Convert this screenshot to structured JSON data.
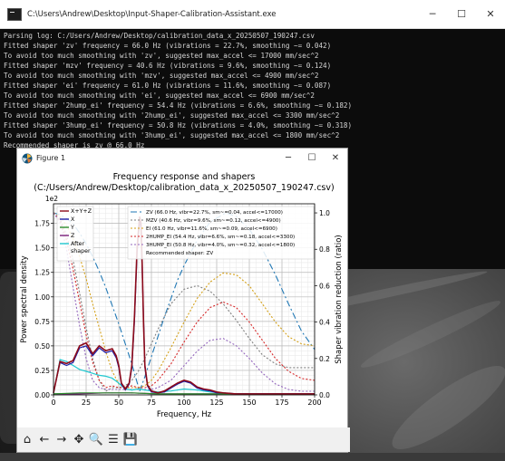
{
  "console": {
    "title": "C:\\Users\\Andrew\\Desktop\\Input-Shaper-Calibration-Assistant.exe",
    "controls": {
      "minimize": "─",
      "maximize": "☐",
      "close": "✕"
    },
    "lines": [
      "Parsing log: C:/Users/Andrew/Desktop/calibration_data_x_20250507_190247.csv",
      "Fitted shaper 'zv' frequency = 66.0 Hz (vibrations = 22.7%, smoothing ~= 0.042)",
      "To avoid too much smoothing with 'zv', suggested max_accel <= 17000 mm/sec^2",
      "Fitted shaper 'mzv' frequency = 40.6 Hz (vibrations = 9.6%, smoothing ~= 0.124)",
      "To avoid too much smoothing with 'mzv', suggested max_accel <= 4900 mm/sec^2",
      "Fitted shaper 'ei' frequency = 61.0 Hz (vibrations = 11.6%, smoothing ~= 0.087)",
      "To avoid too much smoothing with 'ei', suggested max_accel <= 6900 mm/sec^2",
      "Fitted shaper '2hump_ei' frequency = 54.4 Hz (vibrations = 6.6%, smoothing ~= 0.182)",
      "To avoid too much smoothing with '2hump_ei', suggested max_accel <= 3300 mm/sec^2",
      "Fitted shaper '3hump_ei' frequency = 50.8 Hz (vibrations = 4.0%, smoothing ~= 0.318)",
      "To avoid too much smoothing with '3hump_ei', suggested max_accel <= 1800 mm/sec^2",
      "Recommended shaper is zv @ 66.0 Hz"
    ]
  },
  "figure": {
    "title": "Figure 1",
    "controls": {
      "minimize": "─",
      "maximize": "☐",
      "close": "✕"
    },
    "toolbar": [
      "home-icon",
      "back-arrow-icon",
      "forward-arrow-icon",
      "pan-icon",
      "zoom-icon",
      "configure-subplots-icon",
      "save-icon"
    ],
    "toolbar_glyphs": [
      "⌂",
      "←",
      "→",
      "✥",
      "🔍",
      "☰",
      "💾"
    ]
  },
  "chart_data": {
    "type": "line",
    "title": "Frequency response and shapers",
    "subtitle": "(C:/Users/Andrew/Desktop/calibration_data_x_20250507_190247.csv)",
    "xlabel": "Frequency, Hz",
    "ylabel": "Power spectral density",
    "ylabel_right": "Shaper vibration reduction (ratio)",
    "y_multiplier": "1e2",
    "xlim": [
      0,
      200
    ],
    "ylim": [
      0,
      1.95
    ],
    "ylim_right": [
      0,
      1.05
    ],
    "xticks": [
      "0",
      "25",
      "50",
      "75",
      "100",
      "125",
      "150",
      "175",
      "200"
    ],
    "yticks": [
      "0.00",
      "0.25",
      "0.50",
      "0.75",
      "1.00",
      "1.25",
      "1.50",
      "1.75"
    ],
    "yticks_right": [
      "0.0",
      "0.2",
      "0.4",
      "0.6",
      "0.8",
      "1.0"
    ],
    "grid": true,
    "psd_series": [
      {
        "name": "X+Y+Z",
        "color": "#8b0a1a",
        "x": [
          0,
          5,
          10,
          15,
          20,
          25,
          30,
          35,
          40,
          45,
          48,
          50,
          52,
          55,
          58,
          60,
          62,
          64,
          66,
          67,
          68,
          69,
          70,
          72,
          75,
          80,
          85,
          90,
          95,
          100,
          105,
          110,
          115,
          120,
          125,
          130,
          140,
          160,
          180,
          200
        ],
        "y": [
          0.02,
          0.34,
          0.32,
          0.35,
          0.5,
          0.53,
          0.42,
          0.5,
          0.45,
          0.47,
          0.4,
          0.3,
          0.12,
          0.06,
          0.12,
          0.3,
          0.8,
          1.5,
          1.82,
          1.75,
          1.3,
          0.7,
          0.3,
          0.1,
          0.04,
          0.02,
          0.04,
          0.08,
          0.12,
          0.15,
          0.13,
          0.08,
          0.06,
          0.05,
          0.03,
          0.02,
          0.01,
          0.01,
          0.01,
          0.01
        ]
      },
      {
        "name": "X",
        "color": "#1e1ea8",
        "x": [
          0,
          5,
          10,
          15,
          20,
          25,
          30,
          35,
          40,
          45,
          48,
          50,
          52,
          55,
          58,
          60,
          62,
          64,
          66,
          67,
          68,
          70,
          72,
          75,
          80,
          85,
          90,
          95,
          100,
          105,
          110,
          115,
          120,
          125,
          130,
          140,
          160,
          180,
          200
        ],
        "y": [
          0.02,
          0.33,
          0.3,
          0.33,
          0.48,
          0.5,
          0.4,
          0.48,
          0.43,
          0.45,
          0.38,
          0.28,
          0.11,
          0.05,
          0.11,
          0.28,
          0.75,
          1.45,
          1.78,
          1.7,
          1.25,
          0.28,
          0.09,
          0.03,
          0.02,
          0.03,
          0.07,
          0.11,
          0.14,
          0.12,
          0.07,
          0.05,
          0.04,
          0.02,
          0.02,
          0.01,
          0.01,
          0.01,
          0.01
        ]
      },
      {
        "name": "Y",
        "color": "#2c8c2c",
        "x": [
          0,
          20,
          40,
          60,
          80,
          100,
          120,
          140,
          160,
          180,
          200
        ],
        "y": [
          0.01,
          0.02,
          0.02,
          0.02,
          0.01,
          0.01,
          0.01,
          0.01,
          0.01,
          0.01,
          0.01
        ]
      },
      {
        "name": "Z",
        "color": "#7a1f7a",
        "x": [
          0,
          20,
          40,
          60,
          80,
          100,
          120,
          140,
          160,
          180,
          200
        ],
        "y": [
          0.01,
          0.01,
          0.02,
          0.02,
          0.01,
          0.01,
          0.01,
          0.01,
          0.01,
          0.01,
          0.01
        ]
      },
      {
        "name": "After\nshaper",
        "color": "#20c8d0",
        "x": [
          0,
          5,
          10,
          15,
          20,
          25,
          30,
          35,
          40,
          45,
          50,
          55,
          60,
          65,
          70,
          75,
          80,
          90,
          100,
          110,
          120,
          130,
          140,
          160,
          180,
          200
        ],
        "y": [
          0.02,
          0.36,
          0.34,
          0.3,
          0.26,
          0.24,
          0.22,
          0.2,
          0.19,
          0.17,
          0.12,
          0.06,
          0.05,
          0.06,
          0.05,
          0.04,
          0.03,
          0.04,
          0.06,
          0.05,
          0.03,
          0.02,
          0.01,
          0.01,
          0.01,
          0.01
        ]
      }
    ],
    "shaper_series": [
      {
        "name": "ZV (66.0 Hz, vibr=22.7%, sm~=0.04, accel<=17000)",
        "color": "#1f77b4",
        "dash": "7,3,2,3",
        "x": [
          0,
          5,
          10,
          15,
          20,
          25,
          30,
          35,
          40,
          45,
          50,
          55,
          60,
          66,
          70,
          75,
          80,
          85,
          90,
          95,
          100,
          110,
          120,
          132,
          140,
          150,
          160,
          170,
          180,
          190,
          200
        ],
        "y": [
          1.0,
          0.99,
          0.97,
          0.94,
          0.89,
          0.83,
          0.76,
          0.68,
          0.59,
          0.49,
          0.39,
          0.28,
          0.17,
          0.02,
          0.1,
          0.21,
          0.32,
          0.43,
          0.53,
          0.63,
          0.71,
          0.85,
          0.95,
          1.0,
          0.98,
          0.91,
          0.8,
          0.66,
          0.5,
          0.35,
          0.25
        ]
      },
      {
        "name": "MZV (40.6 Hz, vibr=9.6%, sm~=0.12, accel<=4900)",
        "color": "#7f7f7f",
        "dash": "2,2",
        "x": [
          0,
          5,
          10,
          15,
          20,
          25,
          30,
          35,
          40,
          45,
          50,
          55,
          60,
          65,
          70,
          80,
          90,
          100,
          110,
          120,
          130,
          140,
          150,
          160,
          170,
          180,
          190,
          200
        ],
        "y": [
          1.0,
          0.97,
          0.88,
          0.74,
          0.56,
          0.37,
          0.2,
          0.08,
          0.02,
          0.04,
          0.04,
          0.05,
          0.08,
          0.13,
          0.2,
          0.36,
          0.5,
          0.58,
          0.6,
          0.57,
          0.5,
          0.41,
          0.31,
          0.22,
          0.17,
          0.15,
          0.15,
          0.15
        ]
      },
      {
        "name": "EI (61.0 Hz, vibr=11.6%, sm~=0.09, accel<=6900)",
        "color": "#d4a017",
        "dash": "2,2",
        "x": [
          0,
          5,
          10,
          15,
          20,
          25,
          30,
          35,
          40,
          45,
          50,
          55,
          60,
          65,
          70,
          75,
          80,
          90,
          100,
          110,
          120,
          130,
          140,
          150,
          160,
          170,
          180,
          190,
          200
        ],
        "y": [
          1.0,
          0.98,
          0.93,
          0.86,
          0.76,
          0.64,
          0.5,
          0.37,
          0.24,
          0.13,
          0.06,
          0.04,
          0.04,
          0.04,
          0.05,
          0.08,
          0.13,
          0.26,
          0.4,
          0.53,
          0.62,
          0.67,
          0.66,
          0.6,
          0.5,
          0.4,
          0.32,
          0.28,
          0.27
        ]
      },
      {
        "name": "2HUMP_EI (54.4 Hz, vibr=6.6%, sm~=0.18, accel<=3300)",
        "color": "#d62728",
        "dash": "2,2",
        "x": [
          0,
          5,
          10,
          15,
          20,
          25,
          30,
          35,
          40,
          45,
          50,
          55,
          60,
          65,
          70,
          75,
          80,
          90,
          100,
          110,
          120,
          130,
          140,
          150,
          160,
          170,
          180,
          190,
          200
        ],
        "y": [
          1.0,
          0.96,
          0.85,
          0.69,
          0.51,
          0.33,
          0.18,
          0.08,
          0.04,
          0.05,
          0.04,
          0.04,
          0.05,
          0.04,
          0.04,
          0.05,
          0.08,
          0.17,
          0.29,
          0.4,
          0.48,
          0.51,
          0.48,
          0.4,
          0.3,
          0.2,
          0.13,
          0.09,
          0.08
        ]
      },
      {
        "name": "3HUMP_EI (50.8 Hz, vibr=4.0%, sm~=0.32, accel<=1800)",
        "color": "#9467bd",
        "dash": "2,2",
        "x": [
          0,
          5,
          10,
          15,
          20,
          25,
          30,
          35,
          40,
          45,
          50,
          55,
          60,
          65,
          70,
          75,
          80,
          90,
          100,
          110,
          120,
          130,
          140,
          150,
          160,
          170,
          180,
          190,
          200
        ],
        "y": [
          1.0,
          0.95,
          0.8,
          0.59,
          0.38,
          0.2,
          0.08,
          0.04,
          0.03,
          0.03,
          0.03,
          0.03,
          0.03,
          0.03,
          0.03,
          0.03,
          0.04,
          0.08,
          0.16,
          0.24,
          0.3,
          0.31,
          0.27,
          0.2,
          0.12,
          0.06,
          0.03,
          0.02,
          0.02
        ]
      }
    ],
    "legend_left_position": "top-left",
    "legend_right_position": "top-center",
    "recommended_label": "Recommended shaper: ZV"
  }
}
